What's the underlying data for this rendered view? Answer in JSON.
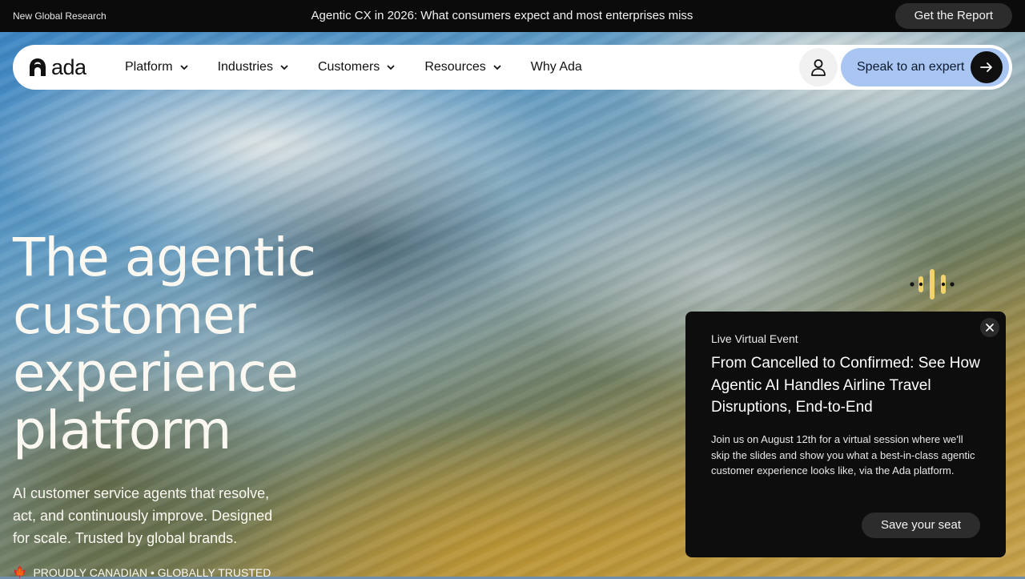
{
  "colors": {
    "banner_bg": "#0b0b0b",
    "cta_bg": "#a9c6f3",
    "popup_bg": "#0d0d0d",
    "hero_text": "#fbf8f2",
    "accent_yellow": "#f2d36b"
  },
  "banner": {
    "tag": "New Global Research",
    "headline": "Agentic CX in 2026: What consumers expect and most enterprises miss",
    "cta_label": "Get the Report"
  },
  "nav": {
    "logo_text": "ada",
    "logo_icon": "ada-logo-icon",
    "items": [
      {
        "label": "Platform",
        "has_dropdown": true
      },
      {
        "label": "Industries",
        "has_dropdown": true
      },
      {
        "label": "Customers",
        "has_dropdown": true
      },
      {
        "label": "Resources",
        "has_dropdown": true
      },
      {
        "label": "Why Ada",
        "has_dropdown": false
      }
    ],
    "account_icon": "user-icon",
    "cta_label": "Speak to an expert",
    "cta_icon": "arrow-right-icon"
  },
  "hero": {
    "title": "The agentic customer experience platform",
    "subtitle": "AI customer service agents that resolve, act, and continuously improve. Designed for scale. Trusted by global brands.",
    "footnote": "PROUDLY CANADIAN • GLOBALLY TRUSTED",
    "footnote_icon": "maple-leaf-icon"
  },
  "voice_widget": {
    "icon": "voice-waveform-icon"
  },
  "popup": {
    "eyebrow": "Live Virtual Event",
    "title": "From Cancelled to Confirmed: See How Agentic AI Handles Airline Travel Disruptions, End-to-End",
    "description": "Join us on August 12th for a virtual session where we'll skip the slides and show you what a best-in-class agentic customer experience looks like, via the Ada platform.",
    "cta_label": "Save your seat",
    "close_icon": "close-icon"
  }
}
